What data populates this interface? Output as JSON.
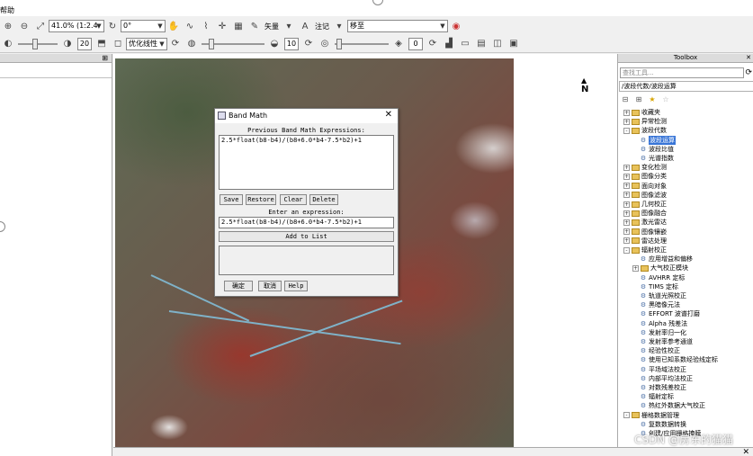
{
  "menubar": {
    "help_label": "帮助"
  },
  "toolbar1": {
    "zoom_value": "41.0% (1:2.4.",
    "rotation_value": "0°",
    "vector_label": "矢量",
    "annotation_label": "注记",
    "mode_value": "移至"
  },
  "toolbar2": {
    "brightness_value": "20",
    "stretch_value": "优化线性",
    "sharpen_value": "10",
    "transparency_value": "0"
  },
  "map": {
    "north_label": "N"
  },
  "dialog": {
    "title": "Band Math",
    "close_glyph": "✕",
    "previous_label": "Previous Band Math Expressions:",
    "previous_expression": "2.5*float(b8-b4)/(b8+6.0*b4-7.5*b2)+1",
    "save_label": "Save",
    "restore_label": "Restore",
    "clear_label": "Clear",
    "delete_label": "Delete",
    "enter_label": "Enter an expression:",
    "expression_value": "2.5*float(b8-b4)/(b8+6.0*b4-7.5*b2)+1",
    "add_label": "Add to List",
    "ok_label": "确定",
    "cancel_label": "取消",
    "help_label": "Help"
  },
  "toolbox": {
    "title": "Toolbox",
    "search_placeholder": "查找工具...",
    "path": "/波段代数/波段运算",
    "items": [
      {
        "label": "收藏夹",
        "kind": "folder",
        "toggle": "+"
      },
      {
        "label": "异常检测",
        "kind": "folder",
        "toggle": "+"
      },
      {
        "label": "波段代数",
        "kind": "folder",
        "toggle": "-"
      },
      {
        "label": "波段运算",
        "kind": "tool",
        "selected": true
      },
      {
        "label": "波段比值",
        "kind": "tool"
      },
      {
        "label": "光谱指数",
        "kind": "tool"
      },
      {
        "label": "变化检测",
        "kind": "folder",
        "toggle": "+"
      },
      {
        "label": "图像分类",
        "kind": "folder",
        "toggle": "+"
      },
      {
        "label": "面向对象",
        "kind": "folder",
        "toggle": "+"
      },
      {
        "label": "图像滤波",
        "kind": "folder",
        "toggle": "+"
      },
      {
        "label": "几何校正",
        "kind": "folder",
        "toggle": "+"
      },
      {
        "label": "图像融合",
        "kind": "folder",
        "toggle": "+"
      },
      {
        "label": "激光雷达",
        "kind": "folder",
        "toggle": "+"
      },
      {
        "label": "图像镶嵌",
        "kind": "folder",
        "toggle": "+"
      },
      {
        "label": "雷达处理",
        "kind": "folder",
        "toggle": "+"
      },
      {
        "label": "辐射校正",
        "kind": "folder",
        "toggle": "-"
      },
      {
        "label": "应用增益和偏移",
        "kind": "tool"
      },
      {
        "label": "大气校正模块",
        "kind": "folder",
        "toggle": "+"
      },
      {
        "label": "AVHRR 定标",
        "kind": "tool"
      },
      {
        "label": "TIMS 定标",
        "kind": "tool"
      },
      {
        "label": "轨道光照校正",
        "kind": "tool"
      },
      {
        "label": "黑暗像元法",
        "kind": "tool"
      },
      {
        "label": "EFFORT 波谱打磨",
        "kind": "tool"
      },
      {
        "label": "Alpha 残差法",
        "kind": "tool"
      },
      {
        "label": "发射率归一化",
        "kind": "tool"
      },
      {
        "label": "发射率参考通道",
        "kind": "tool"
      },
      {
        "label": "经验性校正",
        "kind": "tool"
      },
      {
        "label": "使用已知系数经验线定标",
        "kind": "tool"
      },
      {
        "label": "平场域法校正",
        "kind": "tool"
      },
      {
        "label": "内部平均法校正",
        "kind": "tool"
      },
      {
        "label": "对数残差校正",
        "kind": "tool"
      },
      {
        "label": "辐射定标",
        "kind": "tool"
      },
      {
        "label": "热红外数据大气校正",
        "kind": "tool"
      },
      {
        "label": "栅格数据管理",
        "kind": "folder",
        "toggle": "-"
      },
      {
        "label": "复数数据转换",
        "kind": "tool"
      },
      {
        "label": "创建/应用栅格掩膜",
        "kind": "tool"
      }
    ]
  },
  "watermark": "CSDN @房东的猫猫",
  "footer": {
    "close_glyph": "✕"
  }
}
